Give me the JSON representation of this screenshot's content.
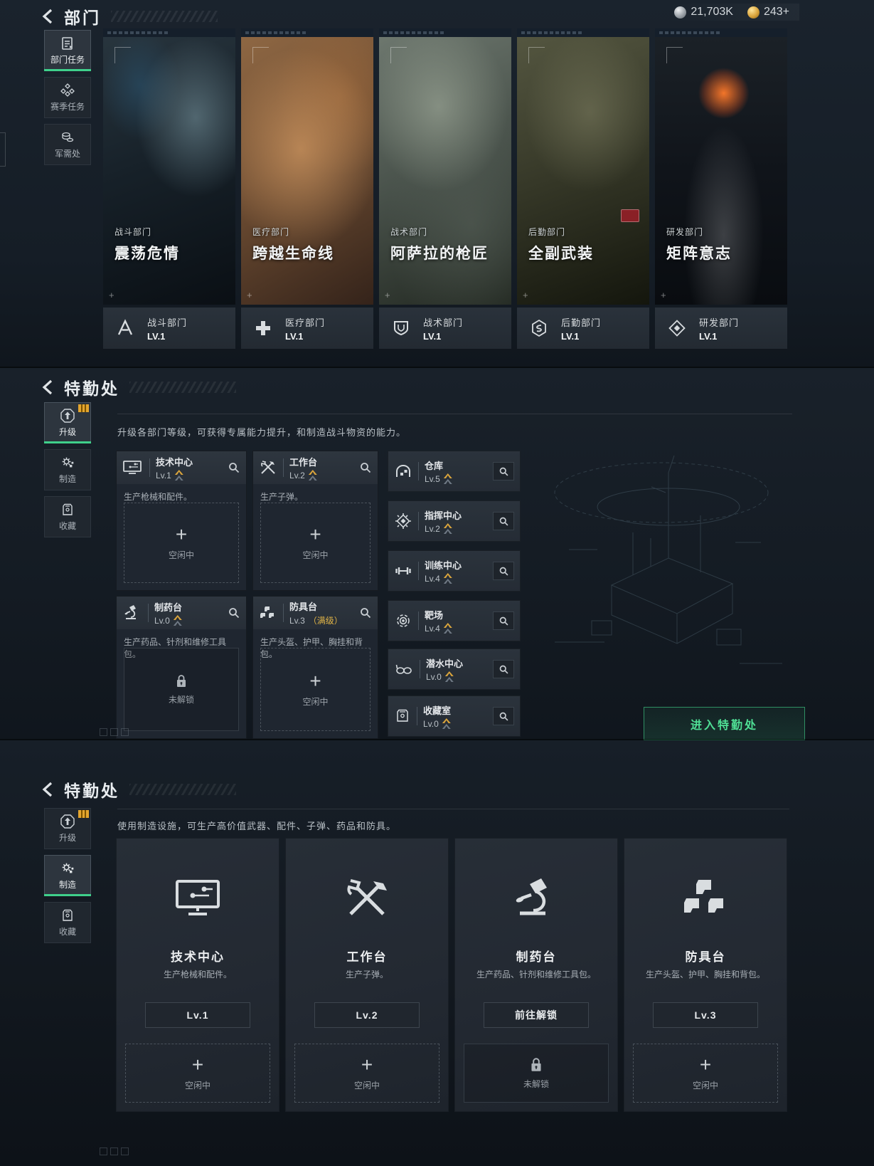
{
  "currency": {
    "silver": "21,703K",
    "gold": "243+"
  },
  "colors": {
    "accent_green": "#3fd08b",
    "gold": "#d9a43c"
  },
  "dept_section": {
    "title": "部门",
    "sidebar": [
      {
        "label": "部门任务"
      },
      {
        "label": "赛季任务"
      },
      {
        "label": "军需处"
      }
    ],
    "cards": [
      {
        "dept": "战斗部门",
        "mission": "震荡危情",
        "level": "LV.1"
      },
      {
        "dept": "医疗部门",
        "mission": "跨越生命线",
        "level": "LV.1"
      },
      {
        "dept": "战术部门",
        "mission": "阿萨拉的枪匠",
        "level": "LV.1"
      },
      {
        "dept": "后勤部门",
        "mission": "全副武装",
        "level": "LV.1"
      },
      {
        "dept": "研发部门",
        "mission": "矩阵意志",
        "level": "LV.1"
      }
    ]
  },
  "upgrade_section": {
    "title": "特勤处",
    "sidebar": {
      "upgrade": "升级",
      "craft": "制造",
      "collection": "收藏"
    },
    "description": "升级各部门等级，可获得专属能力提升，和制造战斗物资的能力。",
    "facilities": [
      {
        "name": "技术中心",
        "level": "Lv.1",
        "desc": "生产枪械和配件。",
        "status": "空闲中"
      },
      {
        "name": "工作台",
        "level": "Lv.2",
        "desc": "生产子弹。",
        "status": "空闲中"
      },
      {
        "name": "制药台",
        "level": "Lv.0",
        "desc": "生产药品、针剂和维修工具包。",
        "status": "未解锁"
      },
      {
        "name": "防具台",
        "level": "Lv.3",
        "max_tag": "（满级）",
        "desc": "生产头盔、护甲、胸挂和背包。",
        "status": "空闲中"
      }
    ],
    "buildings": [
      {
        "name": "仓库",
        "level": "Lv.5"
      },
      {
        "name": "指挥中心",
        "level": "Lv.2"
      },
      {
        "name": "训练中心",
        "level": "Lv.4"
      },
      {
        "name": "靶场",
        "level": "Lv.4"
      },
      {
        "name": "潜水中心",
        "level": "Lv.0"
      },
      {
        "name": "收藏室",
        "level": "Lv.0"
      }
    ],
    "enter_button": "进入特勤处"
  },
  "craft_section": {
    "title": "特勤处",
    "sidebar": {
      "upgrade": "升级",
      "craft": "制造",
      "collection": "收藏"
    },
    "description": "使用制造设施，可生产高价值武器、配件、子弹、药品和防具。",
    "stations": [
      {
        "name": "技术中心",
        "desc": "生产枪械和配件。",
        "button": "Lv.1",
        "status": "空闲中"
      },
      {
        "name": "工作台",
        "desc": "生产子弹。",
        "button": "Lv.2",
        "status": "空闲中"
      },
      {
        "name": "制药台",
        "desc": "生产药品、针剂和维修工具包。",
        "button": "前往解锁",
        "status": "未解锁"
      },
      {
        "name": "防具台",
        "desc": "生产头盔、护甲、胸挂和背包。",
        "button": "Lv.3",
        "status": "空闲中"
      }
    ]
  }
}
